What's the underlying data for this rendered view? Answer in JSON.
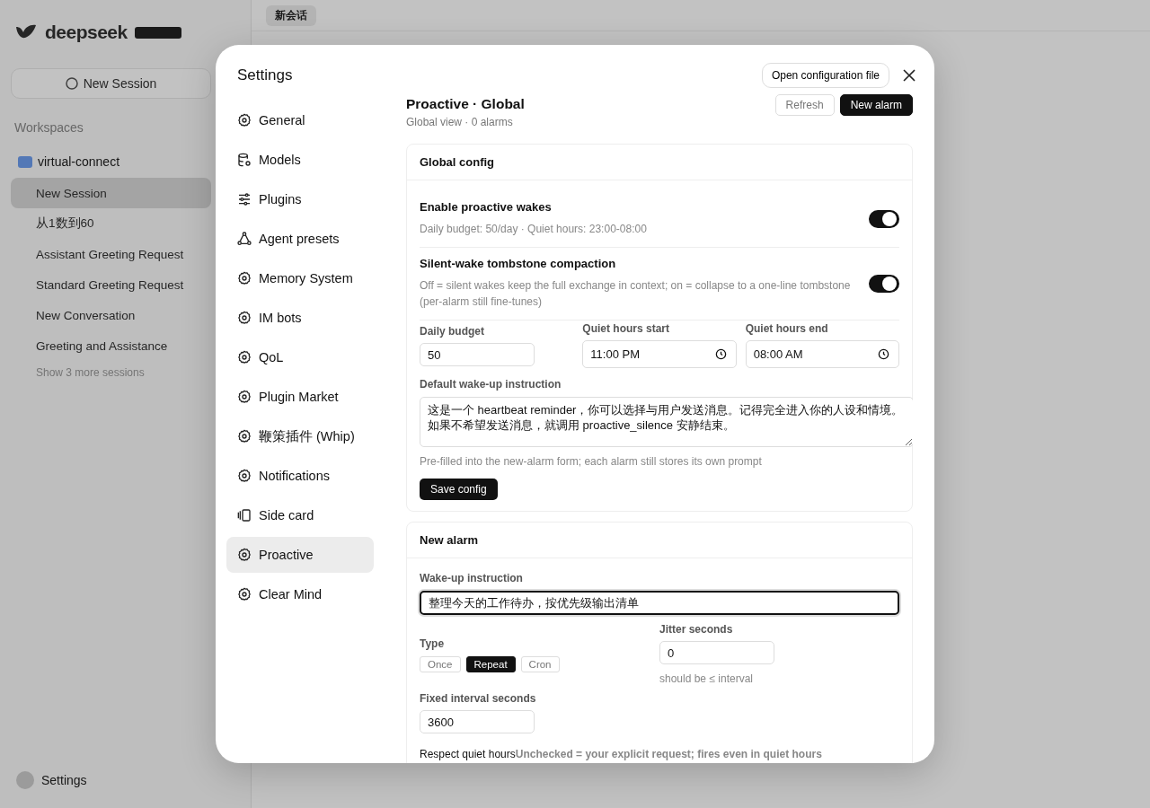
{
  "background": {
    "brand": "deepseek",
    "tab": "新会话",
    "new_session": "New Session",
    "workspaces_label": "Workspaces",
    "workspace": "virtual-connect",
    "sessions": [
      {
        "title": "New Session",
        "selected": true
      },
      {
        "title": "从1数到60",
        "selected": false
      },
      {
        "title": "Assistant Greeting Request",
        "selected": false
      },
      {
        "title": "Standard Greeting Request",
        "selected": false
      },
      {
        "title": "New Conversation",
        "selected": false
      },
      {
        "title": "Greeting and Assistance",
        "selected": false
      }
    ],
    "more": "Show 3 more sessions",
    "settings": "Settings"
  },
  "modal": {
    "title": "Settings",
    "open_config": "Open configuration file",
    "nav": [
      {
        "label": "General",
        "selected": false
      },
      {
        "label": "Models",
        "selected": false
      },
      {
        "label": "Plugins",
        "selected": false
      },
      {
        "label": "Agent presets",
        "selected": false
      },
      {
        "label": "Memory System",
        "selected": false
      },
      {
        "label": "IM bots",
        "selected": false
      },
      {
        "label": "QoL",
        "selected": false
      },
      {
        "label": "Plugin Market",
        "selected": false
      },
      {
        "label": "鞭策插件 (Whip)",
        "selected": false
      },
      {
        "label": "Notifications",
        "selected": false
      },
      {
        "label": "Side card",
        "selected": false
      },
      {
        "label": "Proactive",
        "selected": true
      },
      {
        "label": "Clear Mind",
        "selected": false
      }
    ],
    "page": {
      "title": "Proactive · Global",
      "subtitle": "Global view · 0 alarms",
      "buttons": [
        {
          "label": "Refresh",
          "primary": false
        },
        {
          "label": "New alarm",
          "primary": true
        }
      ]
    },
    "global_config": {
      "title": "Global config",
      "toggles": [
        {
          "label": "Enable proactive wakes",
          "description": "Daily budget: 50/day · Quiet hours: 23:00-08:00",
          "on": true
        },
        {
          "label": "Silent-wake tombstone compaction",
          "description": "Off = silent wakes keep the full exchange in context; on = collapse to a one-line tombstone (per-alarm still fine-tunes)",
          "on": true
        }
      ],
      "fields": [
        {
          "label": "Daily budget",
          "value": "50",
          "kind": "number"
        },
        {
          "label": "Quiet hours start",
          "value": "11:00 PM",
          "kind": "time"
        },
        {
          "label": "Quiet hours end",
          "value": "08:00 AM",
          "kind": "time"
        }
      ],
      "instruction": {
        "label": "Default wake-up instruction",
        "value": "这是一个 heartbeat reminder，你可以选择与用户发送消息。记得完全进入你的人设和情境。如果不希望发送消息，就调用 proactive_silence 安静结束。",
        "hint": "Pre-filled into the new-alarm form; each alarm still stores its own prompt"
      },
      "save": "Save config"
    },
    "new_alarm": {
      "title": "New alarm",
      "instruction": {
        "label": "Wake-up instruction",
        "value": "整理今天的工作待办，按优先级输出清单",
        "focused": true
      },
      "type": {
        "label": "Type",
        "options": [
          {
            "label": "Once",
            "selected": false
          },
          {
            "label": "Repeat",
            "selected": true
          },
          {
            "label": "Cron",
            "selected": false
          }
        ]
      },
      "jitter": {
        "label": "Jitter seconds",
        "value": "0",
        "hint": "should be ≤ interval"
      },
      "interval": {
        "label": "Fixed interval seconds",
        "value": "3600"
      },
      "respect": {
        "label": "Respect quiet hours",
        "hint": "Unchecked = your explicit request; fires even in quiet hours"
      }
    }
  }
}
